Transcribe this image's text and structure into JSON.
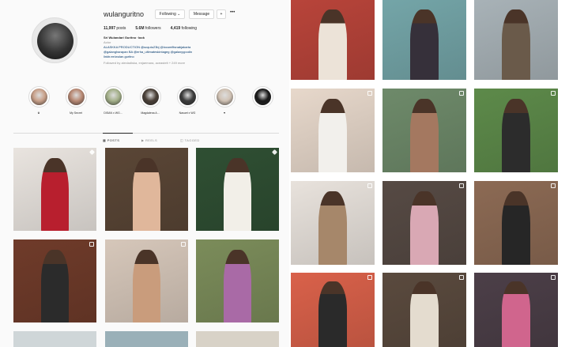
{
  "profile": {
    "username": "wulanguritno",
    "follow_label": "Following",
    "follow_chevron": "⌄",
    "message_label": "Message",
    "suggest_icon": "+&#x1F464;",
    "more_icon": "•••",
    "stats": {
      "posts_num": "11,997",
      "posts_label": "posts",
      "followers_num": "5.6M",
      "followers_label": "followers",
      "following_num": "4,419",
      "following_label": "following"
    },
    "bio": {
      "name": "Sri Wulandari Guritno ·look",
      "category": "Actor",
      "line1": "ALASKKA PRODUCTION @scqutu23bj @locumfitsnabjakarta",
      "line2": "@galangharapan BA @erha_ultimateskintageg @galaxyypodin",
      "link": "linktr.ee/wulan.guritno",
      "followed_by": "Followed by alexladiska, enjaemara, aceastelt + 249 more"
    }
  },
  "highlights": [
    {
      "label": "♛",
      "color": "#c8a089"
    },
    {
      "label": "My Secret",
      "color": "#b88974"
    },
    {
      "label": "DISAN x WG...",
      "color": "#a4b08a"
    },
    {
      "label": "Magdalena A...",
      "color": "#4a4038"
    },
    {
      "label": "Nasuet x WG",
      "color": "#3c3c3c"
    },
    {
      "label": "♥",
      "color": "#d0c2b4"
    },
    {
      "label": "",
      "color": "#1a1a1a"
    }
  ],
  "tabs": [
    {
      "label": "POSTS",
      "active": true
    },
    {
      "label": "REELS",
      "active": false
    },
    {
      "label": "TAGGED",
      "active": false
    }
  ],
  "colors": {
    "link": "#00376b",
    "border": "#dbdbdb",
    "muted": "#8e8e8e",
    "text": "#262626"
  },
  "left_grid": [
    {
      "bg": "#e9e4df",
      "fig": "#b81f2e",
      "mark": "pin"
    },
    {
      "bg": "#5a4636",
      "fig": "#e0b79b",
      "mark": "none"
    },
    {
      "bg": "#2f4f33",
      "fig": "#f2efe8",
      "mark": "pin"
    },
    {
      "bg": "#6f3b2a",
      "fig": "#2b2b2b",
      "mark": "reel"
    },
    {
      "bg": "#d6c7ba",
      "fig": "#c99c7c",
      "mark": "reel"
    },
    {
      "bg": "#7b8c5a",
      "fig": "#a96aa6",
      "mark": "none"
    }
  ],
  "right_grid": [
    {
      "bg": "#b8443a",
      "fig": "#ece3d8",
      "mark": "none"
    },
    {
      "bg": "#74a5a8",
      "fig": "#36303a",
      "mark": "none"
    },
    {
      "bg": "#a8b2b7",
      "fig": "#6a5a4a",
      "mark": "none"
    },
    {
      "bg": "#e7d8cb",
      "fig": "#f2f0ec",
      "mark": "reel"
    },
    {
      "bg": "#6e8a6a",
      "fig": "#a47860",
      "mark": "reel"
    },
    {
      "bg": "#5d8a4a",
      "fig": "#2c2c2c",
      "mark": "reel"
    },
    {
      "bg": "#e8e2dc",
      "fig": "#a6876a",
      "mark": "reel"
    },
    {
      "bg": "#564a44",
      "fig": "#d9a8b4",
      "mark": "reel"
    },
    {
      "bg": "#8c6a54",
      "fig": "#262626",
      "mark": "reel"
    },
    {
      "bg": "#d9614a",
      "fig": "#2a2a2a",
      "mark": "reel"
    },
    {
      "bg": "#5a4a3e",
      "fig": "#e4dccf",
      "mark": "reel"
    },
    {
      "bg": "#4c3f48",
      "fig": "#d0658d",
      "mark": "reel"
    }
  ]
}
